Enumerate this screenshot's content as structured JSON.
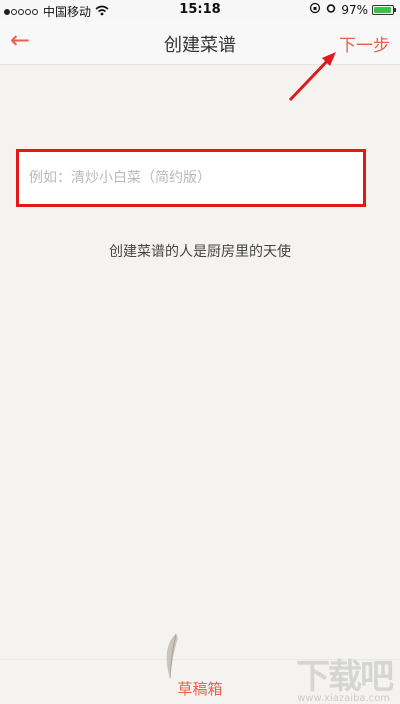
{
  "status_bar": {
    "carrier": "中国移动",
    "time": "15:18",
    "battery": "97%",
    "battery_level": 0.97,
    "battery_color": "#38c34a"
  },
  "nav": {
    "back_icon": "←",
    "title": "创建菜谱",
    "next_label": "下一步"
  },
  "recipe_input": {
    "placeholder": "例如：清炒小白菜（简约版）",
    "value": ""
  },
  "tagline": "创建菜谱的人是厨房里的天使",
  "footer": {
    "drafts_label": "草稿箱"
  },
  "watermark": {
    "text": "下载吧",
    "url": "www.xiazaiba.com"
  },
  "colors": {
    "accent": "#e8604c",
    "highlight_box": "#e0191a",
    "background": "#f5f3ef"
  }
}
